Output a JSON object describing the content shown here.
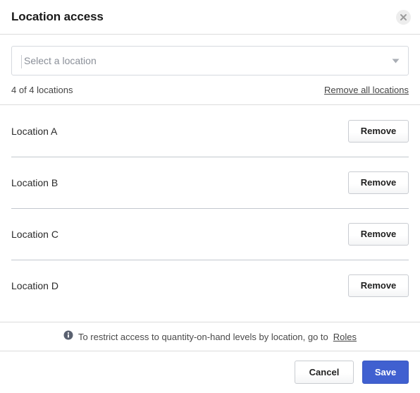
{
  "modal": {
    "title": "Location access",
    "close_icon": "close-icon"
  },
  "select": {
    "placeholder": "Select a location",
    "arrow_icon": "chevron-down-icon"
  },
  "summary": {
    "count_label": "4 of 4 locations",
    "remove_all_label": "Remove all locations"
  },
  "locations": [
    {
      "name": "Location A",
      "remove_label": "Remove"
    },
    {
      "name": "Location B",
      "remove_label": "Remove"
    },
    {
      "name": "Location C",
      "remove_label": "Remove"
    },
    {
      "name": "Location D",
      "remove_label": "Remove"
    }
  ],
  "info": {
    "icon": "info-icon",
    "text": "To restrict access to quantity-on-hand levels by location, go to",
    "link_label": "Roles"
  },
  "footer": {
    "cancel_label": "Cancel",
    "save_label": "Save"
  },
  "colors": {
    "accent": "#4060d0",
    "border": "#dcdcdc",
    "row_divider": "#c3c8cf",
    "text": "#333333",
    "muted_text": "#8a8f98",
    "close_circle": "#ededed"
  }
}
